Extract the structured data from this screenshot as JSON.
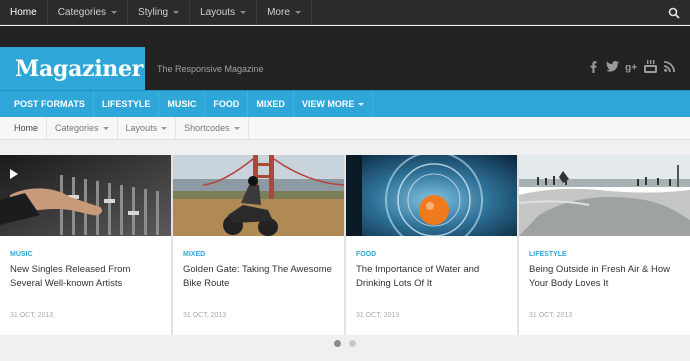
{
  "topnav": [
    {
      "label": "Home",
      "dropdown": false
    },
    {
      "label": "Categories",
      "dropdown": true
    },
    {
      "label": "Styling",
      "dropdown": true
    },
    {
      "label": "Layouts",
      "dropdown": true
    },
    {
      "label": "More",
      "dropdown": true
    }
  ],
  "header": {
    "logo": "Magaziner",
    "tagline": "The Responsive Magazine",
    "social": [
      "facebook-icon",
      "twitter-icon",
      "google-plus-icon",
      "youtube-icon",
      "rss-icon"
    ]
  },
  "catnav": [
    {
      "label": "POST FORMATS"
    },
    {
      "label": "LIFESTYLE"
    },
    {
      "label": "MUSIC"
    },
    {
      "label": "FOOD"
    },
    {
      "label": "MIXED"
    },
    {
      "label": "VIEW MORE",
      "dropdown": true
    }
  ],
  "subnav": [
    {
      "label": "Home"
    },
    {
      "label": "Categories",
      "dropdown": true
    },
    {
      "label": "Layouts",
      "dropdown": true
    },
    {
      "label": "Shortcodes",
      "dropdown": true
    }
  ],
  "slides": [
    {
      "category": "MUSIC",
      "title": "New Singles Released From Several Well-known Artists",
      "date": "31 OCT, 2013"
    },
    {
      "category": "MIXED",
      "title": "Golden Gate: Taking The Awesome Bike Route",
      "date": "31 OCT, 2013"
    },
    {
      "category": "FOOD",
      "title": "The Importance of Water and Drinking Lots Of It",
      "date": "31 OCT, 2013"
    },
    {
      "category": "LIFESTYLE",
      "title": "Being Outside in Fresh Air & How Your Body Loves It",
      "date": "31 OCT, 2013"
    }
  ],
  "colors": {
    "accent": "#2ea7d8",
    "topbar": "#2b2b2b",
    "header": "#222222"
  }
}
